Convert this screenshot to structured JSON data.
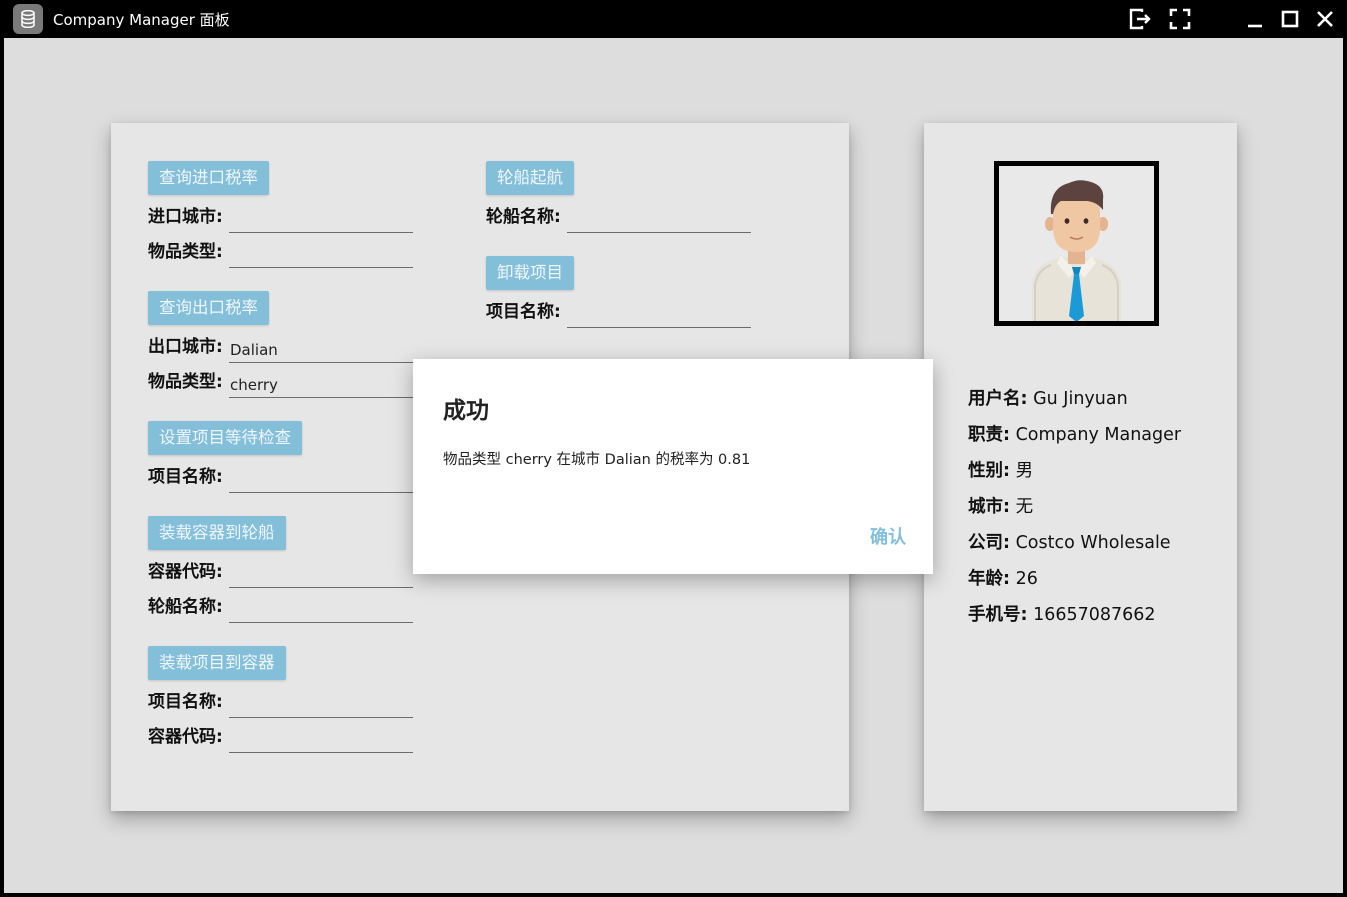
{
  "window": {
    "title": "Company Manager 面板",
    "app_icon": "database-icon",
    "controls": [
      "logout-icon",
      "fullscreen-icon",
      "minimize-icon",
      "maximize-icon",
      "close-icon"
    ]
  },
  "colors": {
    "accent": "#84bfd9",
    "background": "#dddddd",
    "card": "#e6e6e6"
  },
  "left_panel": {
    "import_tax": {
      "button": "查询进口税率",
      "city_label": "进口城市:",
      "city_value": "",
      "type_label": "物品类型:",
      "type_value": ""
    },
    "export_tax": {
      "button": "查询出口税率",
      "city_label": "出口城市:",
      "city_value": "Dalian",
      "type_label": "物品类型:",
      "type_value": "cherry"
    },
    "set_item_wait": {
      "button": "设置项目等待检查",
      "item_label": "项目名称:",
      "item_value": ""
    },
    "load_container_ship": {
      "button": "装载容器到轮船",
      "container_label": "容器代码:",
      "container_value": "",
      "ship_label": "轮船名称:",
      "ship_value": ""
    },
    "load_item_container": {
      "button": "装载项目到容器",
      "item_label": "项目名称:",
      "item_value": "",
      "container_label": "容器代码:",
      "container_value": ""
    },
    "ship_depart": {
      "button": "轮船起航",
      "ship_label": "轮船名称:",
      "ship_value": ""
    },
    "unload_item": {
      "button": "卸载项目",
      "item_label": "项目名称:",
      "item_value": ""
    }
  },
  "profile": {
    "avatar": "user-avatar-icon",
    "rows": [
      {
        "label": "用户名:",
        "value": "Gu Jinyuan"
      },
      {
        "label": "职责:",
        "value": "Company Manager"
      },
      {
        "label": "性别:",
        "value": "男"
      },
      {
        "label": "城市:",
        "value": "无"
      },
      {
        "label": "公司:",
        "value": "Costco Wholesale"
      },
      {
        "label": "年龄:",
        "value": "26"
      },
      {
        "label": "手机号:",
        "value": "16657087662"
      }
    ]
  },
  "dialog": {
    "title": "成功",
    "message": "物品类型 cherry 在城市 Dalian 的税率为 0.81",
    "confirm": "确认"
  }
}
